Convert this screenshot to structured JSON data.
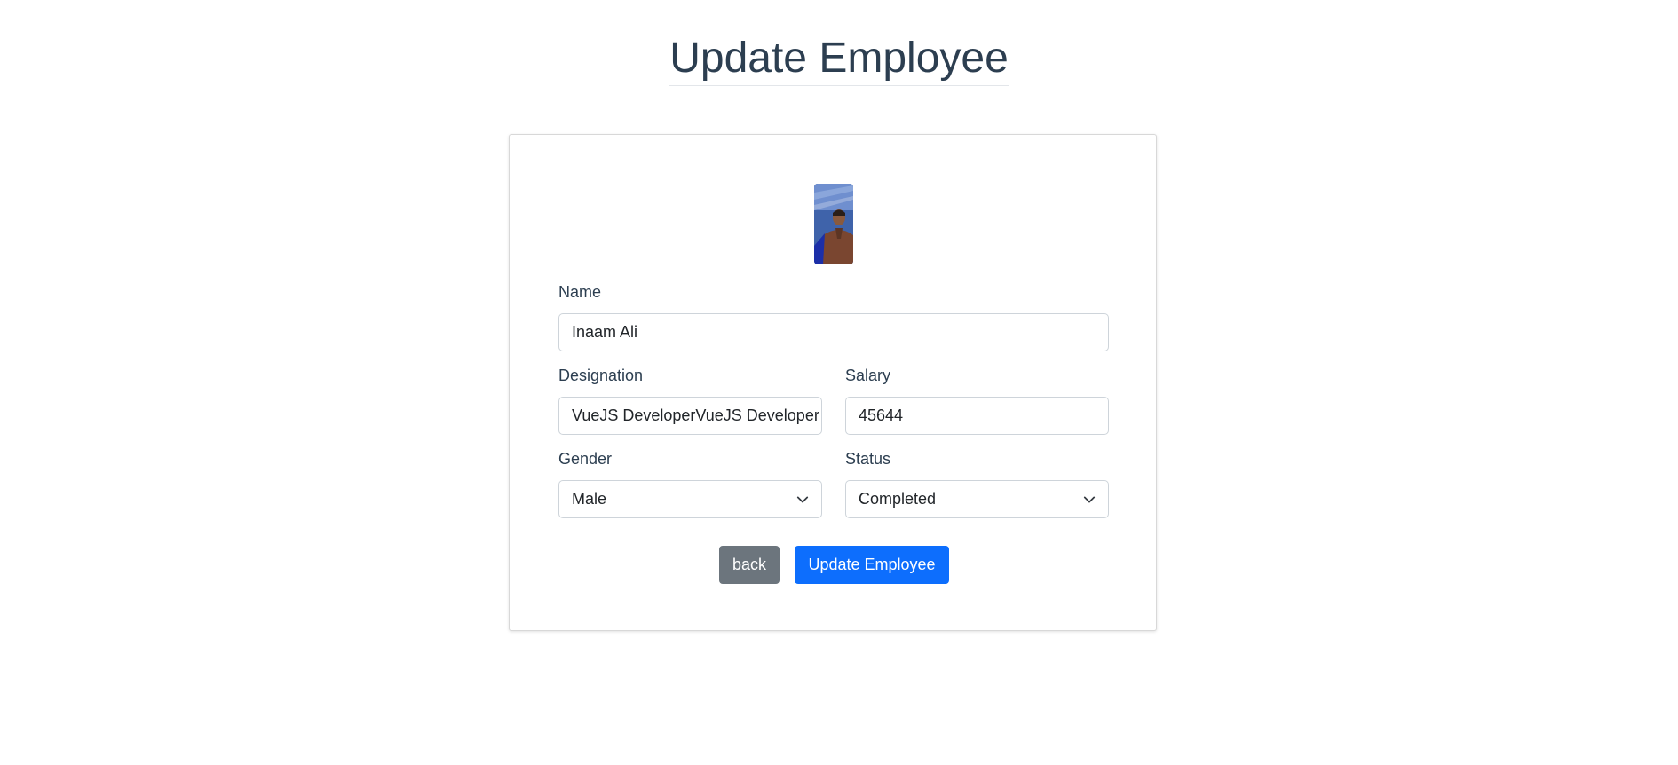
{
  "header": {
    "title": "Update Employee"
  },
  "form": {
    "name": {
      "label": "Name",
      "value": "Inaam Ali"
    },
    "designation": {
      "label": "Designation",
      "value": "VueJS DeveloperVueJS Developer"
    },
    "salary": {
      "label": "Salary",
      "value": "45644"
    },
    "gender": {
      "label": "Gender",
      "selected": "Male"
    },
    "status": {
      "label": "Status",
      "selected": "Completed"
    }
  },
  "buttons": {
    "back_label": "back",
    "update_label": "Update Employee"
  },
  "colors": {
    "primary": "#0d6efd",
    "secondary": "#6c757d",
    "title_text": "#2c3e50"
  },
  "icons": {
    "select_arrow": "chevron-down-icon"
  }
}
